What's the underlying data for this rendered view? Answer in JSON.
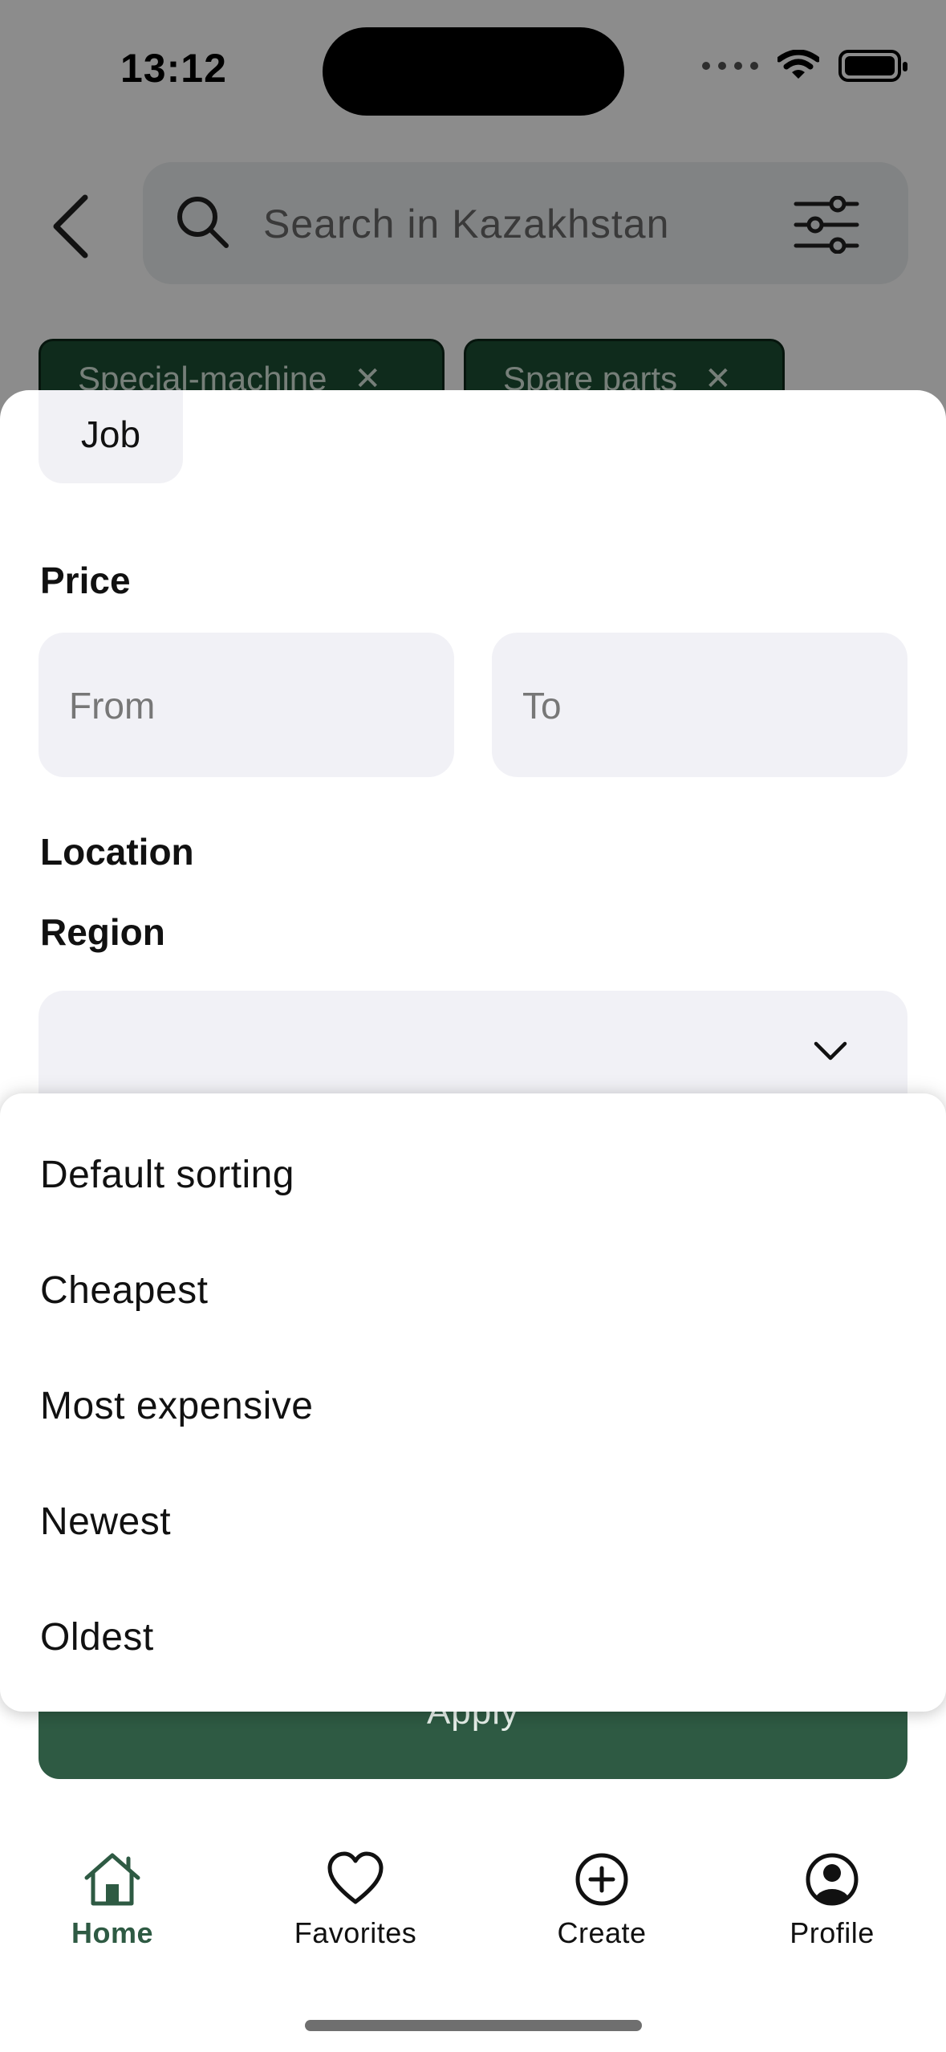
{
  "status_bar": {
    "time": "13:12"
  },
  "search": {
    "placeholder": "Search in Kazakhstan"
  },
  "chips": [
    {
      "label": "Special-machine"
    },
    {
      "label": "Spare parts"
    }
  ],
  "filter_sheet": {
    "category_option": "Job",
    "price_label": "Price",
    "price_from_placeholder": "From",
    "price_to_placeholder": "To",
    "location_label": "Location",
    "region_label": "Region",
    "region_value": "",
    "apply_label": "Apply"
  },
  "sort_menu": {
    "options": [
      "Default sorting",
      "Cheapest",
      "Most expensive",
      "Newest",
      "Oldest"
    ]
  },
  "tabbar": {
    "items": [
      {
        "label": "Home",
        "icon": "home-icon",
        "active": true
      },
      {
        "label": "Favorites",
        "icon": "heart-icon",
        "active": false
      },
      {
        "label": "Create",
        "icon": "plus-circle-icon",
        "active": false
      },
      {
        "label": "Profile",
        "icon": "profile-icon",
        "active": false
      }
    ]
  },
  "colors": {
    "accent": "#2e5a43",
    "chip_bg": "#1d4f33",
    "field_bg": "#f1f1f6"
  }
}
